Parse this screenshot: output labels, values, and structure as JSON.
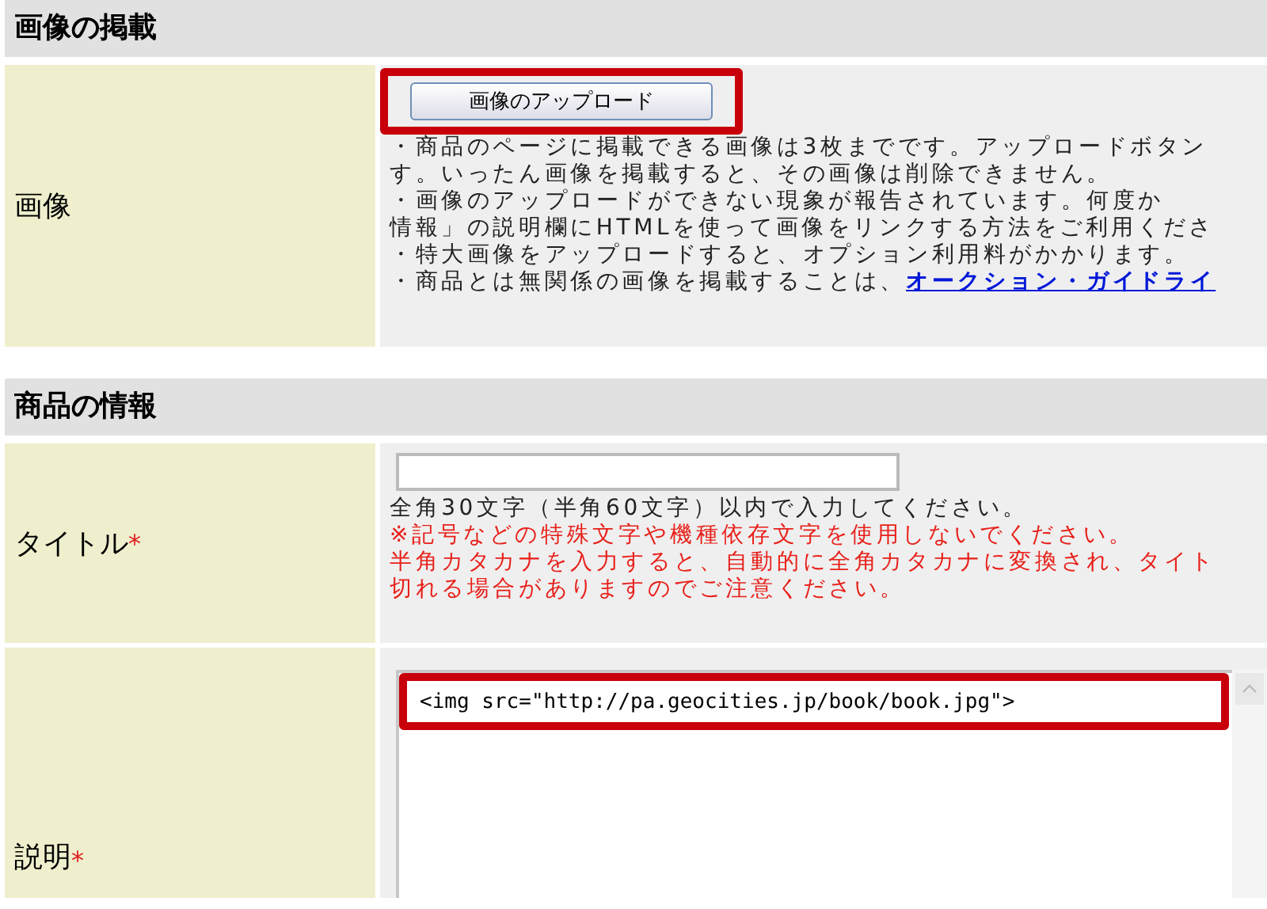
{
  "sections": [
    {
      "heading": "画像の掲載",
      "rows": [
        {
          "kind": "upload",
          "label": "画像",
          "button": {
            "label": "画像のアップロード",
            "highlighted": true
          },
          "notes": [
            {
              "text": "・商品のページに掲載できる画像は3枚までです。アップロードボタン",
              "warning": false
            },
            {
              "text": "す。いったん画像を掲載すると、その画像は削除できません。",
              "warning": false
            },
            {
              "text": "・画像のアップロードができない現象が報告されています。何度か",
              "warning": false
            },
            {
              "text": "情報」の説明欄にHTMLを使って画像をリンクする方法をご利用くださ",
              "warning": false
            },
            {
              "text": "・特大画像をアップロードすると、オプション利用料がかかります。",
              "warning": false
            },
            {
              "text": "・商品とは無関係の画像を掲載することは、",
              "warning": false,
              "link": "オークション・ガイドライ"
            }
          ]
        }
      ]
    },
    {
      "heading": "商品の情報",
      "rows": [
        {
          "kind": "text",
          "label": "タイトル",
          "required_mark": "*",
          "field": {},
          "notes": [
            {
              "text": "全角30文字（半角60文字）以内で入力してください。",
              "warning": false
            },
            {
              "text": "※記号などの特殊文字や機種依存文字を使用しないでください。",
              "warning": true
            },
            {
              "text": "半角カタカナを入力すると、自動的に全角カタカナに変換され、タイト",
              "warning": true
            },
            {
              "text": "切れる場合がありますのでご注意ください。",
              "warning": true
            }
          ]
        },
        {
          "kind": "textarea",
          "label": "説明",
          "required_mark": "*",
          "field": {
            "value": "<img src=\"http://pa.geocities.jp/book/book.jpg\">",
            "highlighted": true
          }
        }
      ]
    }
  ]
}
